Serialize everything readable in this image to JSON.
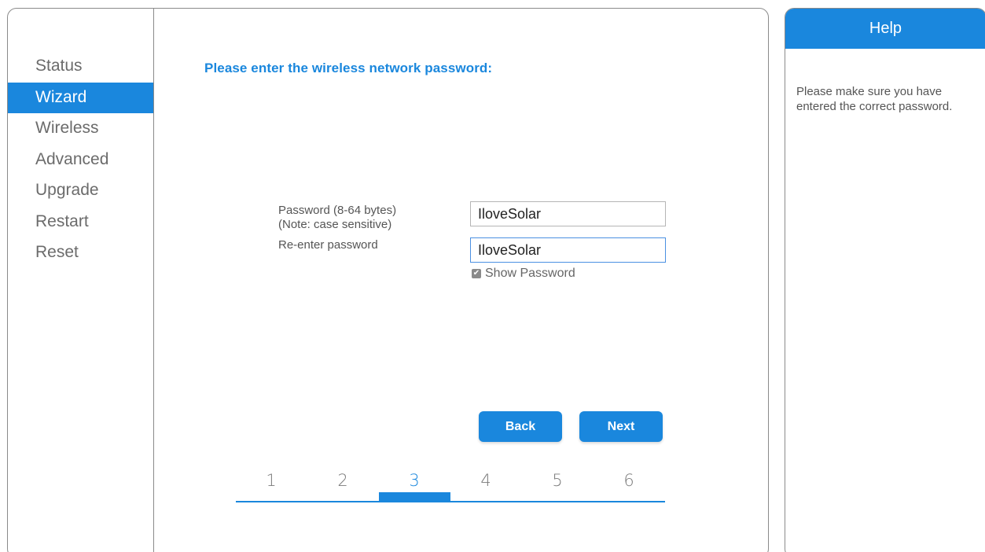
{
  "sidebar": {
    "items": [
      {
        "label": "Status"
      },
      {
        "label": "Wizard",
        "active": true
      },
      {
        "label": "Wireless"
      },
      {
        "label": "Advanced"
      },
      {
        "label": "Upgrade"
      },
      {
        "label": "Restart"
      },
      {
        "label": "Reset"
      }
    ]
  },
  "main": {
    "title": "Please enter the wireless network password:",
    "password_label": "Password (8-64 bytes)",
    "password_note": "(Note: case sensitive)",
    "reenter_label": "Re-enter password",
    "password_value": "IloveSolar",
    "reenter_value": "IloveSolar",
    "show_password_label": "Show Password",
    "show_password_checked": true,
    "back_label": "Back",
    "next_label": "Next",
    "steps": [
      "1",
      "2",
      "3",
      "4",
      "5",
      "6"
    ],
    "current_step": 3
  },
  "help": {
    "title": "Help",
    "text": "Please make sure you have entered the correct password."
  },
  "colors": {
    "accent": "#1a87dd",
    "border": "#8a8a8a"
  }
}
